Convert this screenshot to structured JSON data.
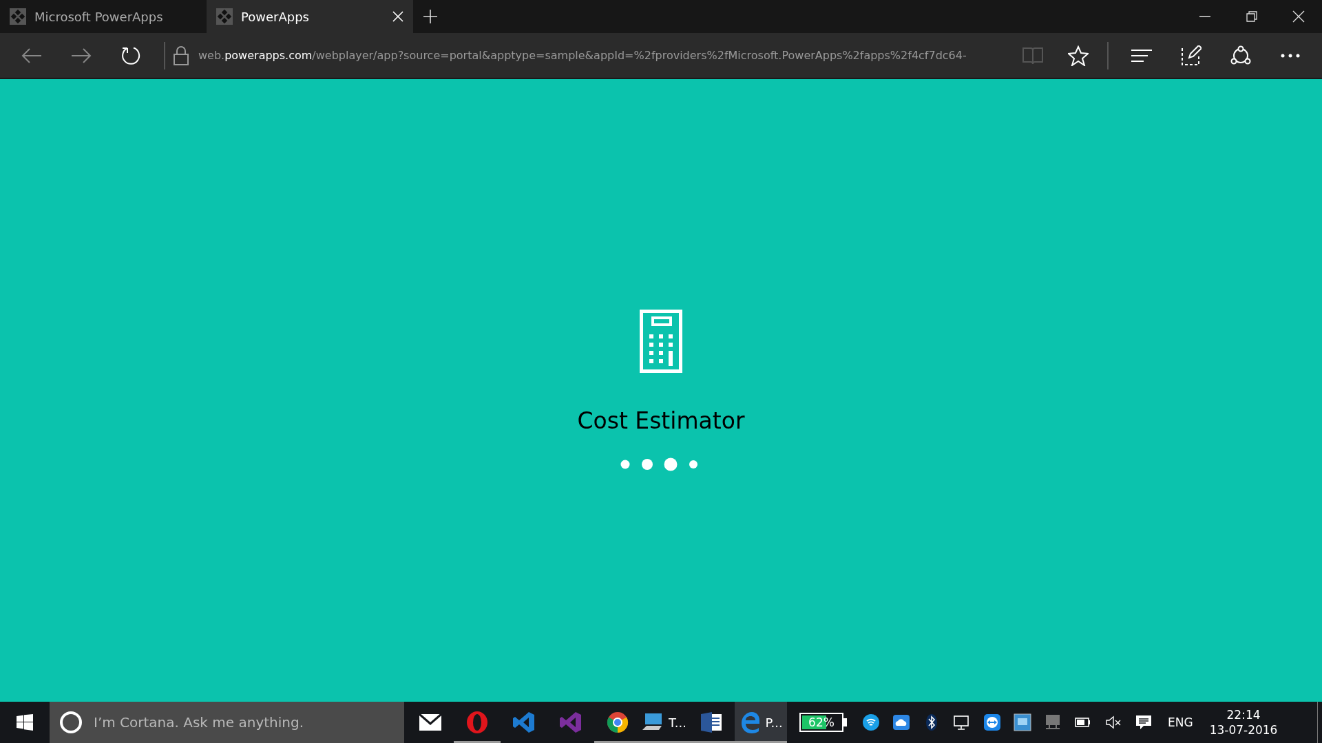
{
  "browser": {
    "tabs": [
      {
        "title": "Microsoft PowerApps",
        "selected": false,
        "closable": false
      },
      {
        "title": "PowerApps",
        "selected": true,
        "closable": true
      }
    ],
    "address": {
      "prefix": "web.",
      "domain": "powerapps.com",
      "path": "/webplayer/app?source=portal&apptype=sample&appId=%2fproviders%2fMicrosoft.PowerApps%2fapps%2f4cf7dc64-"
    }
  },
  "app": {
    "name": "Cost Estimator"
  },
  "taskbar": {
    "search": {
      "placeholder": "I’m Cortana. Ask me anything."
    },
    "apps": [
      {
        "kind": "mail",
        "running": false,
        "selected": false
      },
      {
        "kind": "opera",
        "running": true,
        "selected": false
      },
      {
        "kind": "vscode",
        "running": false,
        "selected": false
      },
      {
        "kind": "visualstudio",
        "running": false,
        "selected": false
      },
      {
        "kind": "chrome",
        "running": true,
        "selected": false
      },
      {
        "kind": "computer",
        "label": "T...",
        "running": true,
        "selected": false
      },
      {
        "kind": "word",
        "running": true,
        "selected": false
      },
      {
        "kind": "edge",
        "label": "P...",
        "running": true,
        "selected": true
      }
    ],
    "battery": {
      "label": "62%",
      "level": 0.62
    },
    "tray": [
      {
        "kind": "shield"
      },
      {
        "kind": "cloud"
      },
      {
        "kind": "bluetooth"
      },
      {
        "kind": "network"
      },
      {
        "kind": "teamviewer"
      },
      {
        "kind": "intel"
      },
      {
        "kind": "display"
      },
      {
        "kind": "battery"
      },
      {
        "kind": "volume-muted"
      },
      {
        "kind": "notification"
      }
    ],
    "language": "ENG",
    "time": "22:14",
    "date": "13-07-2016"
  }
}
